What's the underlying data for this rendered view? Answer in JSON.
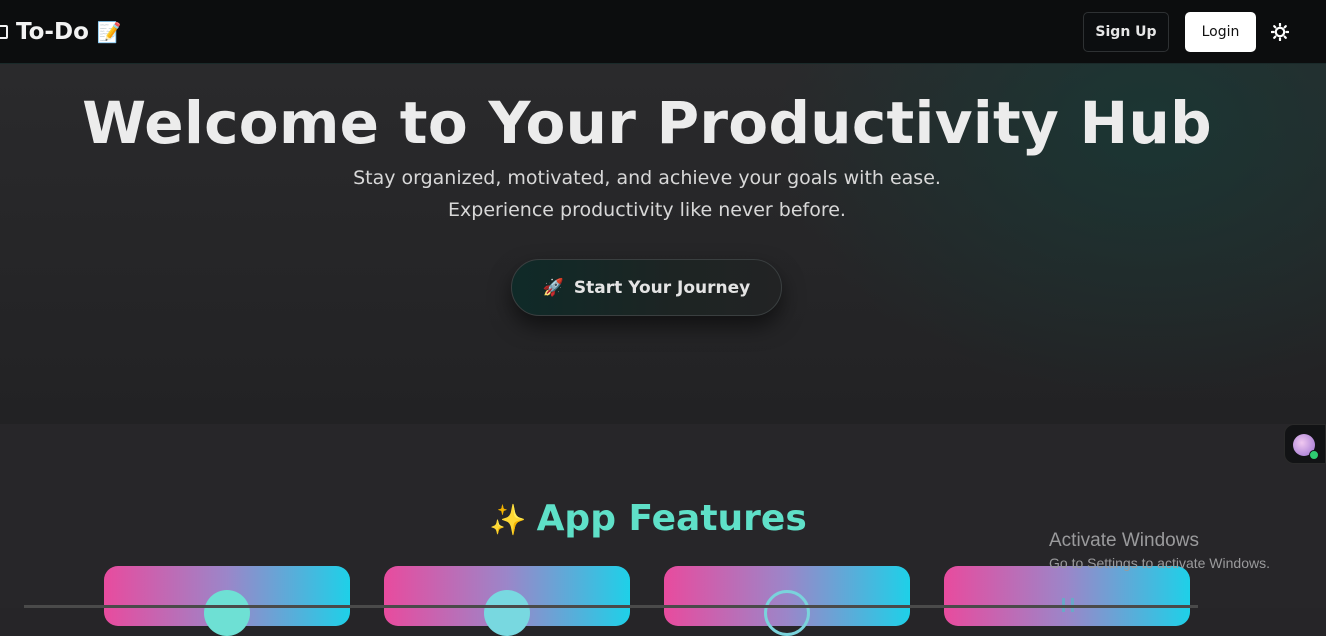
{
  "navbar": {
    "brand_text": "To-Do",
    "brand_icon_left": "laptop-icon",
    "brand_icon_right": "memo-icon",
    "brand_emoji": "📝",
    "signup_label": "Sign Up",
    "login_label": "Login",
    "theme_icon": "sun-icon"
  },
  "hero": {
    "title": "Welcome to Your Productivity Hub",
    "subtitle_line1": "Stay organized, motivated, and achieve your goals with ease.",
    "subtitle_line2": "Experience productivity like never before.",
    "cta_icon": "🚀",
    "cta_label": "Start Your Journey"
  },
  "features": {
    "icon": "✨",
    "title": "App Features"
  },
  "watermark": {
    "title": "Activate Windows",
    "subtitle": "Go to Settings to activate Windows."
  },
  "colors": {
    "accent": "#5fe0c8",
    "card_gradient_start": "#e84b9e",
    "card_gradient_end": "#1ed0e8",
    "login_bg": "#ffffff"
  }
}
